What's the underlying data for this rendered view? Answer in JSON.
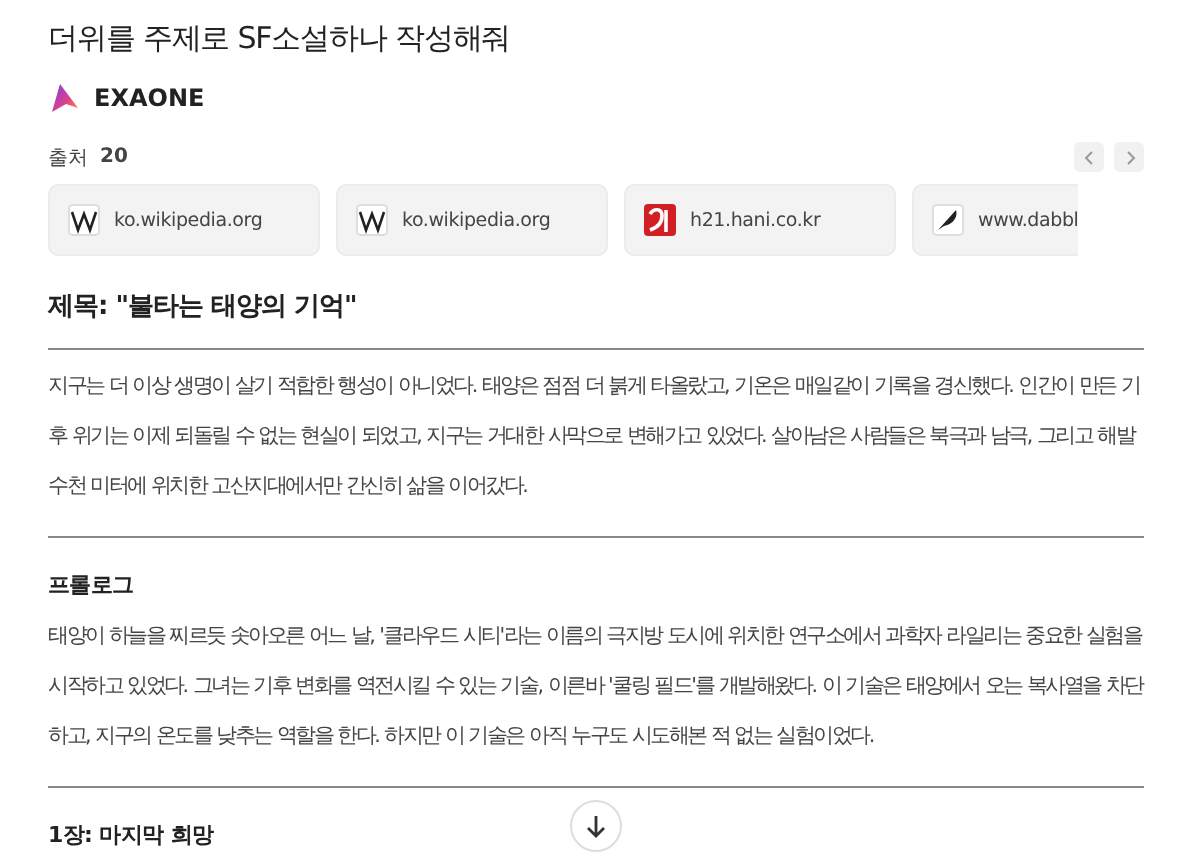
{
  "prompt": "더위를 주제로 SF소설하나 작성해줘",
  "assistant": {
    "name": "EXAONE"
  },
  "sources": {
    "label": "출처",
    "count": "20",
    "items": [
      {
        "kind": "wiki",
        "domain": "ko.wikipedia.org"
      },
      {
        "kind": "wiki",
        "domain": "ko.wikipedia.org"
      },
      {
        "kind": "hani",
        "domain": "h21.hani.co.kr"
      },
      {
        "kind": "quill",
        "domain": "www.dabbl"
      }
    ]
  },
  "blocks": [
    {
      "kind": "title",
      "text": "제목: \"불타는 태양의 기억\""
    },
    {
      "kind": "rule"
    },
    {
      "kind": "paragraph",
      "text": "지구는 더 이상 생명이 살기 적합한 행성이 아니었다. 태양은 점점 더 붉게 타올랐고, 기온은 매일같이 기록을 경신했다. 인간이 만든 기후 위기는 이제 되돌릴 수 없는 현실이 되었고, 지구는 거대한 사막으로 변해가고 있었다. 살아남은 사람들은 북극과 남극, 그리고 해발 수천 미터에 위치한 고산지대에서만 간신히 삶을 이어갔다."
    },
    {
      "kind": "rule"
    },
    {
      "kind": "heading",
      "text": "프롤로그"
    },
    {
      "kind": "paragraph",
      "text": "태양이 하늘을 찌르듯 솟아오른 어느 날, '클라우드 시티'라는 이름의 극지방 도시에 위치한 연구소에서 과학자 라일리는 중요한 실험을 시작하고 있었다. 그녀는 기후 변화를 역전시킬 수 있는 기술, 이른바 '쿨링 필드'를 개발해왔다. 이 기술은 태양에서 오는 복사열을 차단하고, 지구의 온도를 낮추는 역할을 한다. 하지만 이 기술은 아직 누구도 시도해본 적 없는 실험이었다."
    },
    {
      "kind": "rule"
    },
    {
      "kind": "heading",
      "text": "1장: 마지막 희망"
    }
  ]
}
